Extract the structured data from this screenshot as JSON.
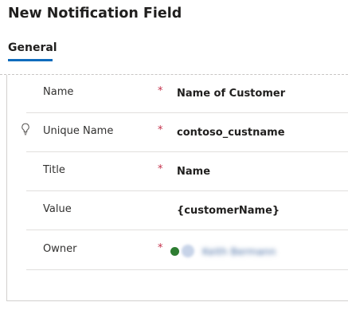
{
  "header": {
    "title": "New Notification Field"
  },
  "tabs": [
    {
      "label": "General",
      "selected": true
    }
  ],
  "form": {
    "rows": [
      {
        "label": "Name",
        "required": true,
        "value": "Name of Customer"
      },
      {
        "label": "Unique Name",
        "required": true,
        "value": "contoso_custname",
        "has_info_icon": true
      },
      {
        "label": "Title",
        "required": true,
        "value": "Name"
      },
      {
        "label": "Value",
        "required": false,
        "value": "{customerName}"
      },
      {
        "label": "Owner",
        "required": true,
        "value": "Keith Bermann"
      }
    ],
    "required_marker": "*"
  },
  "colors": {
    "accent": "#0f6cbd",
    "required": "#c4314b",
    "presence": "#2e7d32"
  },
  "icons": {
    "info": "lightbulb-icon",
    "presence": "presence-dot-icon",
    "avatar": "user-avatar-icon"
  }
}
